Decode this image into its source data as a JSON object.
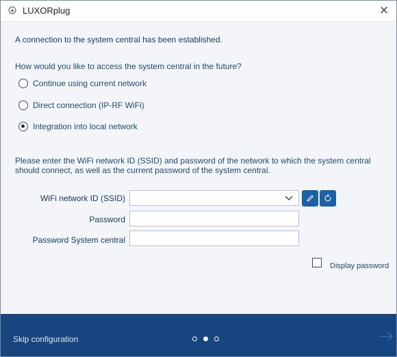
{
  "window": {
    "title": "LUXORplug",
    "close_label": "×"
  },
  "main": {
    "status_message": "A connection to the system central has been established.",
    "question": "How would you like to access the system central in the future?",
    "options": [
      {
        "label": "Continue using current network",
        "selected": false
      },
      {
        "label": "Direct connection (IP-RF WiFi)",
        "selected": false
      },
      {
        "label": "Integration into local network",
        "selected": true
      }
    ],
    "instruction": "Please enter the  WiFi network ID (SSID) and password of the network to which the system central should connect, as well as the current password of the system central."
  },
  "form": {
    "ssid_label": "WiFi network ID (SSID)",
    "ssid_value": "",
    "password_label": "Password",
    "password_value": "",
    "central_password_label": "Password System central",
    "central_password_value": "",
    "display_password_label": "Display password",
    "display_password_checked": false
  },
  "icons": {
    "app": "plug-icon",
    "edit": "pencil-icon",
    "refresh": "refresh-icon",
    "dropdown": "chevron-down-icon",
    "next": "arrow-right-icon"
  },
  "footer": {
    "skip_label": "Skip configuration",
    "steps": [
      {
        "state": "open"
      },
      {
        "state": "current"
      },
      {
        "state": "open"
      }
    ]
  },
  "colors": {
    "accent": "#1b61a8",
    "footer_bg": "#174580",
    "text": "#1a4b7c",
    "content_bg": "#f3f5f8"
  }
}
